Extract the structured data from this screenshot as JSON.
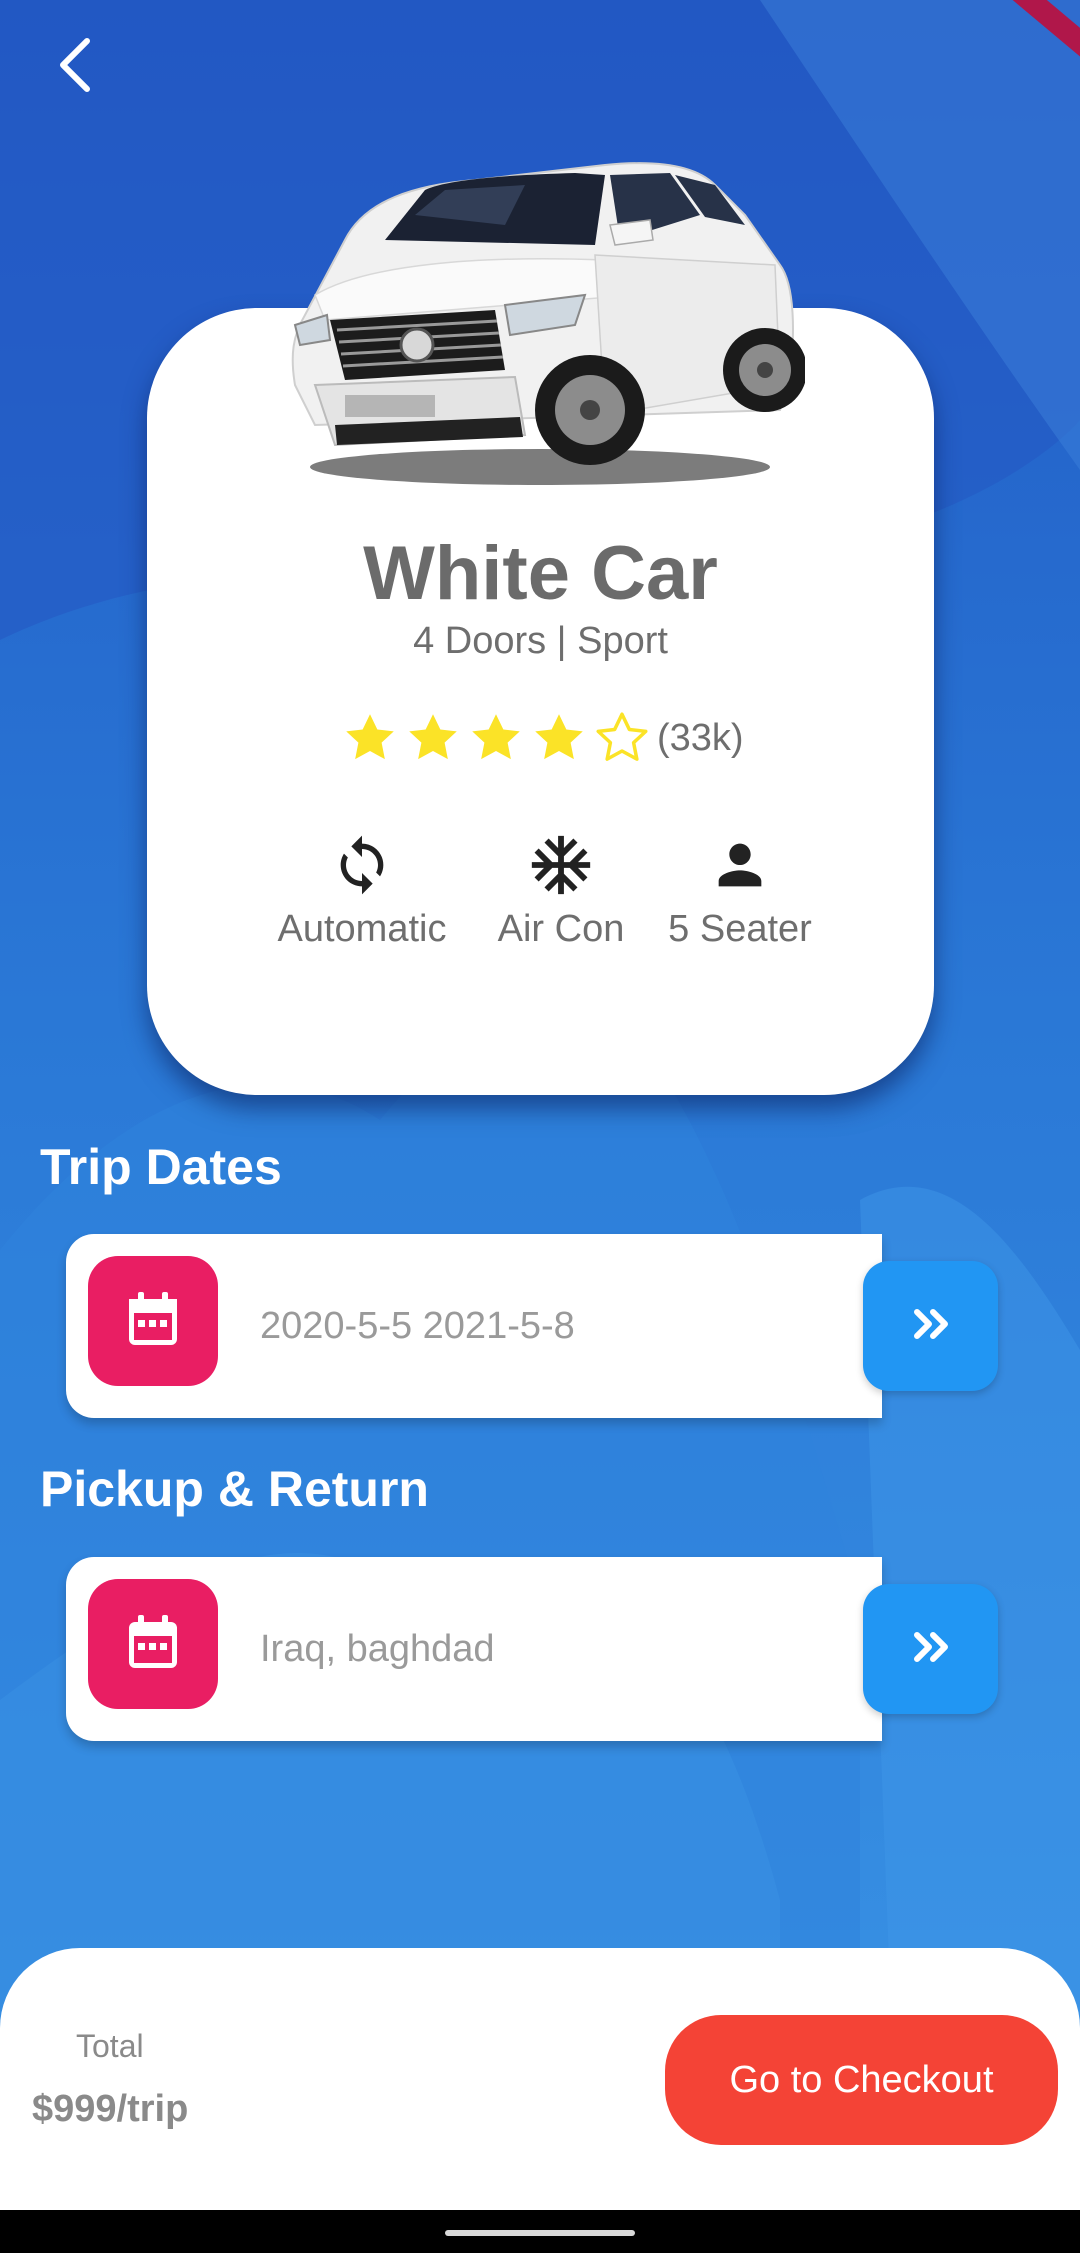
{
  "car": {
    "name": "White Car",
    "subtitle": "4 Doors | Sport",
    "rating": 4,
    "rating_max": 5,
    "rating_count": "(33k)",
    "features": [
      {
        "label": "Automatic",
        "icon": "sync-icon"
      },
      {
        "label": "Air Con",
        "icon": "snowflake-icon"
      },
      {
        "label": "5 Seater",
        "icon": "person-icon"
      }
    ]
  },
  "trip_dates": {
    "title": "Trip Dates",
    "value": "2020-5-5 2021-5-8"
  },
  "pickup": {
    "title": "Pickup & Return",
    "value": "Iraq, baghdad"
  },
  "checkout": {
    "total_label": "Total",
    "total_value": "$999/trip",
    "button_label": "Go to Checkout"
  },
  "colors": {
    "background": "#2f7fd8",
    "calendar_button": "#e91e63",
    "next_button": "#2196f3",
    "checkout_button": "#f44336",
    "star": "#fbe327"
  }
}
